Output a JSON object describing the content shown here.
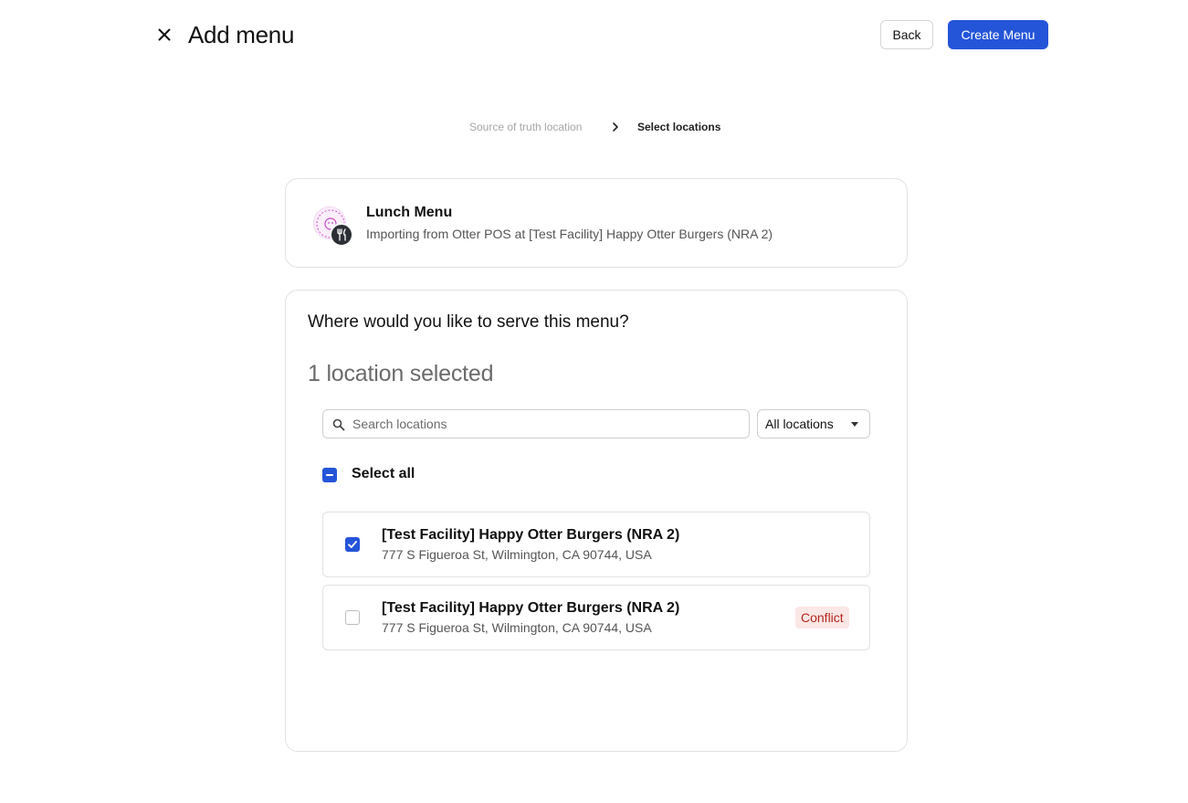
{
  "header": {
    "title": "Add menu",
    "back_label": "Back",
    "create_label": "Create Menu"
  },
  "stepper": {
    "steps": [
      "Source of truth location",
      "Select locations"
    ],
    "current_index": 1
  },
  "menu": {
    "name": "Lunch Menu",
    "subtitle": "Importing from Otter POS at [Test Facility] Happy Otter Burgers (NRA 2)",
    "logo_text": "HAPPY OTTER"
  },
  "locations_panel": {
    "question": "Where would you like to serve this menu?",
    "selected_count_label": "1 location selected",
    "search": {
      "placeholder": "Search locations",
      "value": ""
    },
    "filter": {
      "selected": "All locations"
    },
    "select_all_label": "Select all",
    "select_all_state": "indeterminate",
    "locations": [
      {
        "name": "[Test Facility] Happy Otter Burgers (NRA 2)",
        "address": "777 S Figueroa St, Wilmington, CA 90744, USA",
        "checked": true,
        "badge": ""
      },
      {
        "name": "[Test Facility] Happy Otter Burgers (NRA 2)",
        "address": "777 S Figueroa St, Wilmington, CA 90744, USA",
        "checked": false,
        "badge": "Conflict"
      }
    ]
  },
  "colors": {
    "primary": "#2454d8",
    "conflict_text": "#b3261e",
    "conflict_bg": "#fbe7e5",
    "muted_text": "#6b6b6b",
    "border": "#e2e2e2"
  }
}
